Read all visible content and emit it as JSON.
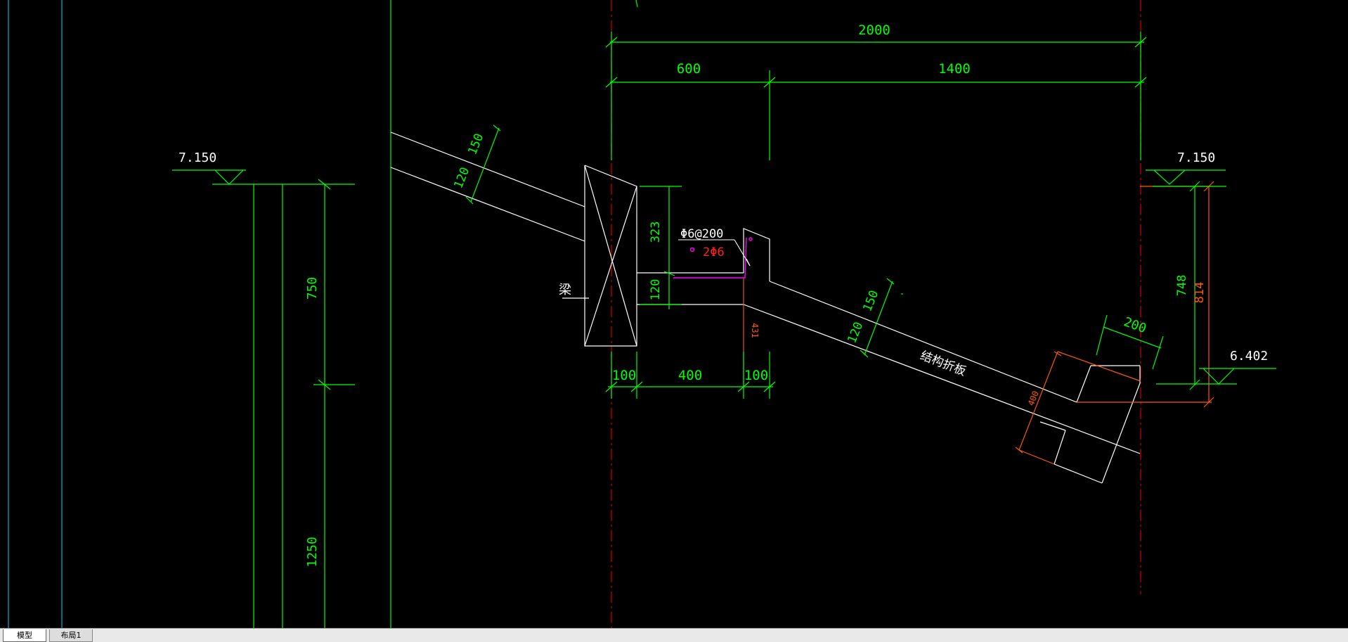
{
  "colors": {
    "background": "#000000",
    "dimension": "#00ff00",
    "structure": "#ffffff",
    "cyan": "#00b4d8",
    "centerline": "#c00000",
    "orange": "#ff5a00",
    "magenta": "#ff00ff",
    "rebar_text": "#ff2020"
  },
  "drawing": {
    "dims_top": {
      "overall": "2000",
      "left": "600",
      "right": "1400"
    },
    "left_elevation": "7.150",
    "right_elevation": "7.150",
    "lower_right_elevation": "6.402",
    "left_column_dims": {
      "upper": "750",
      "lower": "1250"
    },
    "upper_slab_dims": {
      "d1": "150",
      "d2": "120"
    },
    "beam_dims": {
      "height": "323",
      "slab": "120"
    },
    "beam_label": "梁",
    "rebar_callout": {
      "stirrup": "Φ6@200",
      "bars": "2Φ6"
    },
    "notch_dim": "431",
    "bottom_dims": {
      "d1": "100",
      "d2": "400",
      "d3": "100"
    },
    "slab_dims": {
      "d1": "150",
      "d2": "120"
    },
    "slab_label": "结构折板",
    "end_dims": {
      "width": "200",
      "depth": "400"
    },
    "right_dims": {
      "inner": "748",
      "outer": "814"
    }
  },
  "tabs": [
    {
      "label": "模型",
      "active": true
    },
    {
      "label": "布局1",
      "active": false
    }
  ]
}
